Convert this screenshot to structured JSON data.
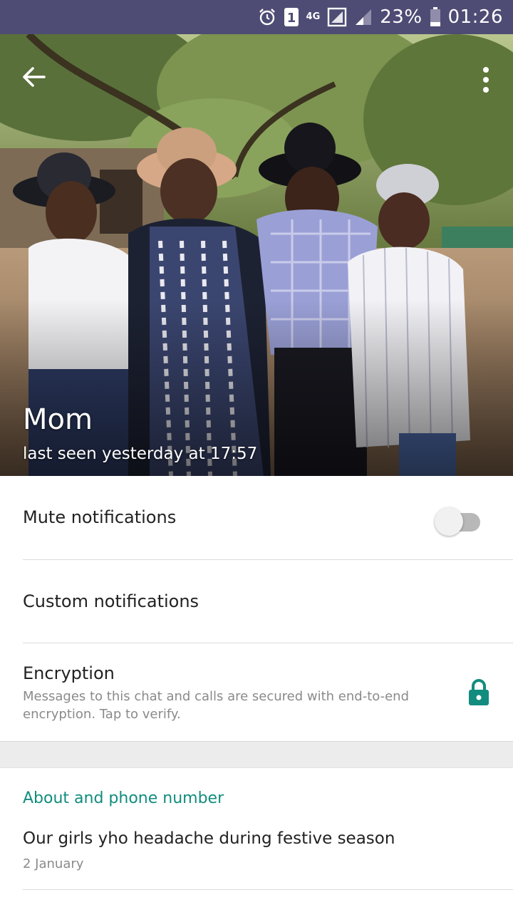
{
  "status_bar": {
    "network": "4G",
    "battery_percent": "23%",
    "time": "01:26",
    "sim_slot": "1",
    "icons": [
      "alarm-icon",
      "sim-icon",
      "network-4g-icon",
      "no-signal-icon",
      "signal-icon",
      "battery-icon"
    ]
  },
  "header": {
    "contact_name": "Mom",
    "last_seen": "last seen yesterday at 17:57",
    "back_icon": "arrow-back-icon",
    "menu_icon": "more-vert-icon"
  },
  "settings": {
    "mute_label": "Mute notifications",
    "mute_enabled": false,
    "custom_label": "Custom notifications",
    "encryption_label": "Encryption",
    "encryption_desc": "Messages to this chat and calls are secured with end-to-end encryption. Tap to verify.",
    "encryption_icon": "lock-icon"
  },
  "about": {
    "heading": "About and phone number",
    "status_text": "Our girls yho headache during festive season",
    "status_date": "2 January"
  },
  "colors": {
    "status_bar_bg": "#4e4c74",
    "accent": "#128c7e",
    "lock_icon": "#128c7e"
  }
}
